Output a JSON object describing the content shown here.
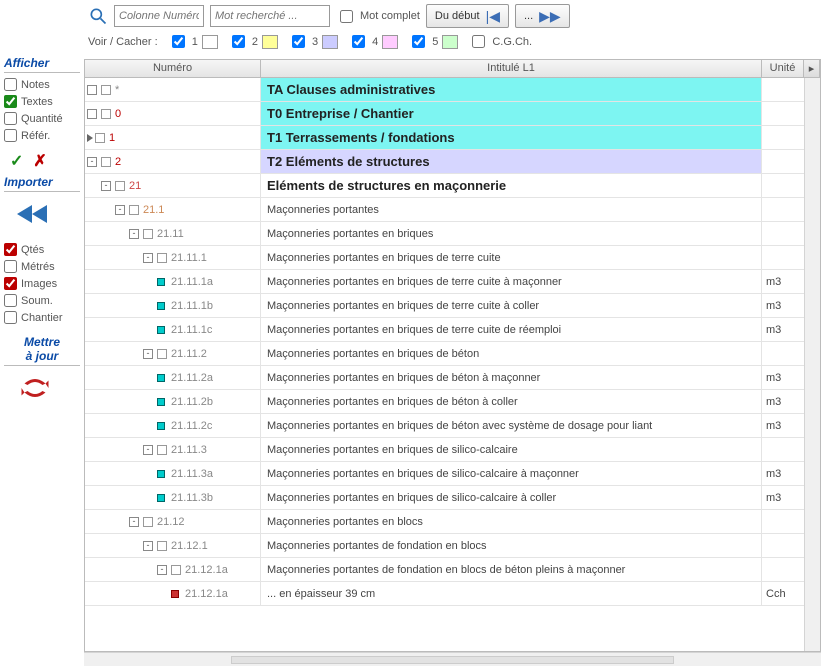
{
  "toolbar": {
    "colInput": "Colonne Numéro",
    "searchInput": "Mot recherché ...",
    "wholeWord": "Mot complet",
    "fromStart": "Du début",
    "dots": "..."
  },
  "filterbar": {
    "label": "Voir / Cacher :",
    "opts": [
      "1",
      "2",
      "3",
      "4",
      "5"
    ],
    "cgch": "C.G.Ch."
  },
  "sidebar": {
    "afficher": "Afficher",
    "notes": "Notes",
    "textes": "Textes",
    "quantite": "Quantité",
    "refer": "Référ.",
    "importer": "Importer",
    "qtes": "Qtés",
    "metres": "Métrés",
    "images": "Images",
    "soum": "Soum.",
    "chantier": "Chantier",
    "mettre": "Mettre\nà jour"
  },
  "grid": {
    "headers": {
      "num": "Numéro",
      "intitule": "Intitulé L1",
      "unite": "Unité"
    },
    "rows": [
      {
        "style": "top",
        "indent": 0,
        "exp": " ",
        "mark": "cb",
        "num": "*",
        "text": "TA Clauses administratives",
        "unit": ""
      },
      {
        "style": "top",
        "indent": 0,
        "exp": " ",
        "mark": "cb",
        "num": "0",
        "numcls": "lvl0",
        "text": "T0 Entreprise / Chantier",
        "unit": ""
      },
      {
        "style": "top",
        "indent": 0,
        "exp": "play",
        "mark": "cb",
        "num": "1",
        "numcls": "lvl0",
        "text": "T1 Terrassements / fondations",
        "unit": ""
      },
      {
        "style": "sel",
        "indent": 0,
        "exp": "-",
        "mark": "cb",
        "num": "2",
        "numcls": "lvl0",
        "text": "T2 Eléments de structures",
        "unit": ""
      },
      {
        "style": "b1",
        "indent": 1,
        "exp": "-",
        "mark": "cb",
        "num": "21",
        "numcls": "lvl1",
        "text": "Eléments de structures en maçonnerie",
        "unit": ""
      },
      {
        "style": "b2",
        "indent": 2,
        "exp": "-",
        "mark": "cb",
        "num": "21.1",
        "numcls": "lvl2",
        "text": "Maçonneries portantes",
        "unit": ""
      },
      {
        "style": "b2",
        "indent": 3,
        "exp": "-",
        "mark": "cb",
        "num": "21.11",
        "text": "Maçonneries portantes en briques",
        "unit": ""
      },
      {
        "style": "b2",
        "indent": 4,
        "exp": "-",
        "mark": "cb",
        "num": "21.11.1",
        "text": "Maçonneries portantes en briques de terre cuite",
        "unit": ""
      },
      {
        "style": "b2",
        "indent": 5,
        "exp": "",
        "mark": "bul",
        "num": "21.11.1a",
        "text": "Maçonneries portantes en briques de terre cuite à maçonner",
        "unit": "m3"
      },
      {
        "style": "b2",
        "indent": 5,
        "exp": "",
        "mark": "bul",
        "num": "21.11.1b",
        "text": "Maçonneries portantes en briques de terre cuite à coller",
        "unit": "m3"
      },
      {
        "style": "b2",
        "indent": 5,
        "exp": "",
        "mark": "bul",
        "num": "21.11.1c",
        "text": "Maçonneries portantes en briques de terre cuite de réemploi",
        "unit": "m3"
      },
      {
        "style": "b2",
        "indent": 4,
        "exp": "-",
        "mark": "cb",
        "num": "21.11.2",
        "text": "Maçonneries portantes en briques de béton",
        "unit": ""
      },
      {
        "style": "b2",
        "indent": 5,
        "exp": "",
        "mark": "bul",
        "num": "21.11.2a",
        "text": "Maçonneries portantes en briques de béton à maçonner",
        "unit": "m3"
      },
      {
        "style": "b2",
        "indent": 5,
        "exp": "",
        "mark": "bul",
        "num": "21.11.2b",
        "text": "Maçonneries portantes en briques de béton à coller",
        "unit": "m3"
      },
      {
        "style": "b2",
        "indent": 5,
        "exp": "",
        "mark": "bul",
        "num": "21.11.2c",
        "text": "Maçonneries portantes en briques de béton avec système de dosage pour liant",
        "unit": "m3"
      },
      {
        "style": "b2",
        "indent": 4,
        "exp": "-",
        "mark": "cb",
        "num": "21.11.3",
        "text": "Maçonneries portantes en briques de silico-calcaire",
        "unit": ""
      },
      {
        "style": "b2",
        "indent": 5,
        "exp": "",
        "mark": "bul",
        "num": "21.11.3a",
        "text": "Maçonneries portantes en briques de silico-calcaire à maçonner",
        "unit": "m3"
      },
      {
        "style": "b2",
        "indent": 5,
        "exp": "",
        "mark": "bul",
        "num": "21.11.3b",
        "text": "Maçonneries portantes en briques de silico-calcaire à coller",
        "unit": "m3"
      },
      {
        "style": "b2",
        "indent": 3,
        "exp": "-",
        "mark": "cb",
        "num": "21.12",
        "text": "Maçonneries portantes en blocs",
        "unit": ""
      },
      {
        "style": "b2",
        "indent": 4,
        "exp": "-",
        "mark": "cb",
        "num": "21.12.1",
        "text": "Maçonneries portantes de fondation en blocs",
        "unit": ""
      },
      {
        "style": "b2",
        "indent": 5,
        "exp": "-",
        "mark": "cb",
        "num": "21.12.1a",
        "text": "Maçonneries portantes de fondation en blocs de béton pleins à maçonner",
        "unit": ""
      },
      {
        "style": "b2",
        "indent": 6,
        "exp": "",
        "mark": "bulred",
        "num": "21.12.1a",
        "text": "... en épaisseur 39 cm",
        "unit": "Cch"
      }
    ]
  }
}
